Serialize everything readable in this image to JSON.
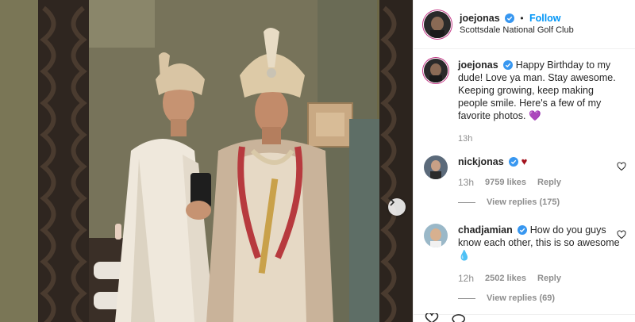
{
  "post": {
    "username": "joejonas",
    "follow_label": "Follow",
    "location": "Scottsdale National Golf Club",
    "separator": "•"
  },
  "caption": {
    "username": "joejonas",
    "text": "Happy Birthday to my dude! Love ya man. Stay awesome. Keeping growing, keep making people smile. Here's a few of my favorite photos.",
    "emoji": "💜",
    "time": "13h"
  },
  "comments": [
    {
      "username": "nickjonas",
      "text": "",
      "emoji": "♥",
      "time": "13h",
      "likes": "9759 likes",
      "reply_label": "Reply",
      "view_replies": "View replies (175)"
    },
    {
      "username": "chadjamian",
      "text": "How do you guys know each other, this is so awesome",
      "emoji": "💧",
      "time": "12h",
      "likes": "2502 likes",
      "reply_label": "Reply",
      "view_replies": "View replies (69)"
    }
  ],
  "colors": {
    "link_blue": "#0095f6",
    "verified_blue": "#3897f0",
    "muted_text": "#8e8e8e",
    "heart_red": "#a3111d"
  },
  "icons": [
    "chevron-right-icon",
    "verified-badge-icon",
    "heart-outline-icon",
    "like-icon",
    "comment-icon"
  ]
}
